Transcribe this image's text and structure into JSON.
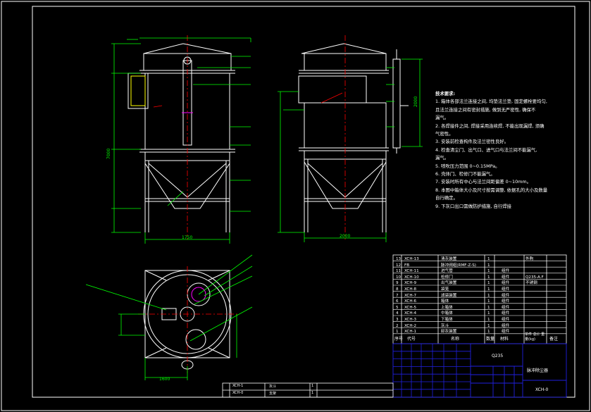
{
  "drawing": {
    "technical_notes": {
      "title": "技术要求:",
      "lines": [
        "1. 箱体各部法兰连接之间, 均垫法兰垫, 固定螺栓要均匀,",
        "且法兰连接之间有密封措施, 做到无严密性, 确保不",
        "漏气。",
        "2. 各焊接件之间, 焊接采用连续焊, 不能出现漏焊, 须确",
        "气密性。",
        "3. 安装前检查构件及法兰密性良好。",
        "4. 检查清尘门、出气口、进气口与法兰间不能漏气,",
        "漏气。",
        "5. 喷吹压力范围 0~0.15MPa。",
        "6. 壳体门、检修门不能漏气。",
        "7. 安装时所有中心与法兰间距偏差 0~10mm。",
        "8. 本图中箱体大小及尺寸按需调整, 依据孔的大小及数量",
        "自行确定。",
        "9. 下灰口出口需做防护措施, 自行焊接"
      ]
    },
    "bom_rows": [
      {
        "no": "13",
        "code": "XCH-13",
        "name": "清灰装置",
        "qty": "1",
        "material": "",
        "note": "外购"
      },
      {
        "no": "12",
        "code": "FB",
        "name": "脉冲阀组(RMF-Z-S)",
        "qty": "1",
        "material": "",
        "note": ""
      },
      {
        "no": "11",
        "code": "XCH-11",
        "name": "进气管",
        "qty": "1",
        "material": "组件",
        "note": ""
      },
      {
        "no": "10",
        "code": "XCH-10",
        "name": "检修门",
        "qty": "1",
        "material": "组件",
        "note": "Q235-A.F"
      },
      {
        "no": "9",
        "code": "XCH-9",
        "name": "出气装置",
        "qty": "1",
        "material": "组件",
        "note": "不锈钢"
      },
      {
        "no": "8",
        "code": "XCH-8",
        "name": "袋笼",
        "qty": "1",
        "material": "组件",
        "note": ""
      },
      {
        "no": "7",
        "code": "XCH-7",
        "name": "滤袋装置",
        "qty": "1",
        "material": "组件",
        "note": ""
      },
      {
        "no": "6",
        "code": "XCH-6",
        "name": "箱体",
        "qty": "1",
        "material": "组件",
        "note": ""
      },
      {
        "no": "5",
        "code": "XCH-5",
        "name": "上箱体",
        "qty": "1",
        "material": "组件",
        "note": ""
      },
      {
        "no": "4",
        "code": "XCH-4",
        "name": "中箱体",
        "qty": "1",
        "material": "组件",
        "note": ""
      },
      {
        "no": "3",
        "code": "XCH-3",
        "name": "下箱体",
        "qty": "1",
        "material": "组件",
        "note": ""
      },
      {
        "no": "2",
        "code": "XCH-2",
        "name": "灰斗",
        "qty": "1",
        "material": "组件",
        "note": ""
      },
      {
        "no": "1",
        "code": "XCH-1",
        "name": "卸灰装置",
        "qty": "1",
        "material": "组件",
        "note": ""
      }
    ],
    "bom_header": {
      "no": "序号",
      "code": "代号",
      "name": "名称",
      "qty": "数量",
      "material": "材料",
      "weight": "单件 总计 重量(kg)",
      "note": "备注"
    },
    "bottom_rows": [
      {
        "code": "XCH-1",
        "name": "灰斗",
        "qty": "1"
      },
      {
        "code": "XCH-0",
        "name": "支架",
        "qty": "1"
      }
    ],
    "title_block": {
      "material_mark": "Q235",
      "drawing_name": "脉冲除尘器",
      "drawing_code": "XCH-0"
    },
    "dimension_labels": {
      "front_width": "1750",
      "side_width": "2000",
      "height_main": "7000",
      "height_upper": "2000",
      "plan_width": "1600"
    },
    "colors": {
      "outline": "#ffffff",
      "dimension": "#00ff00",
      "center": "#ff0000",
      "border": "#ffffff",
      "frame_blue": "#1010c0",
      "leader": "#00ff00"
    }
  }
}
